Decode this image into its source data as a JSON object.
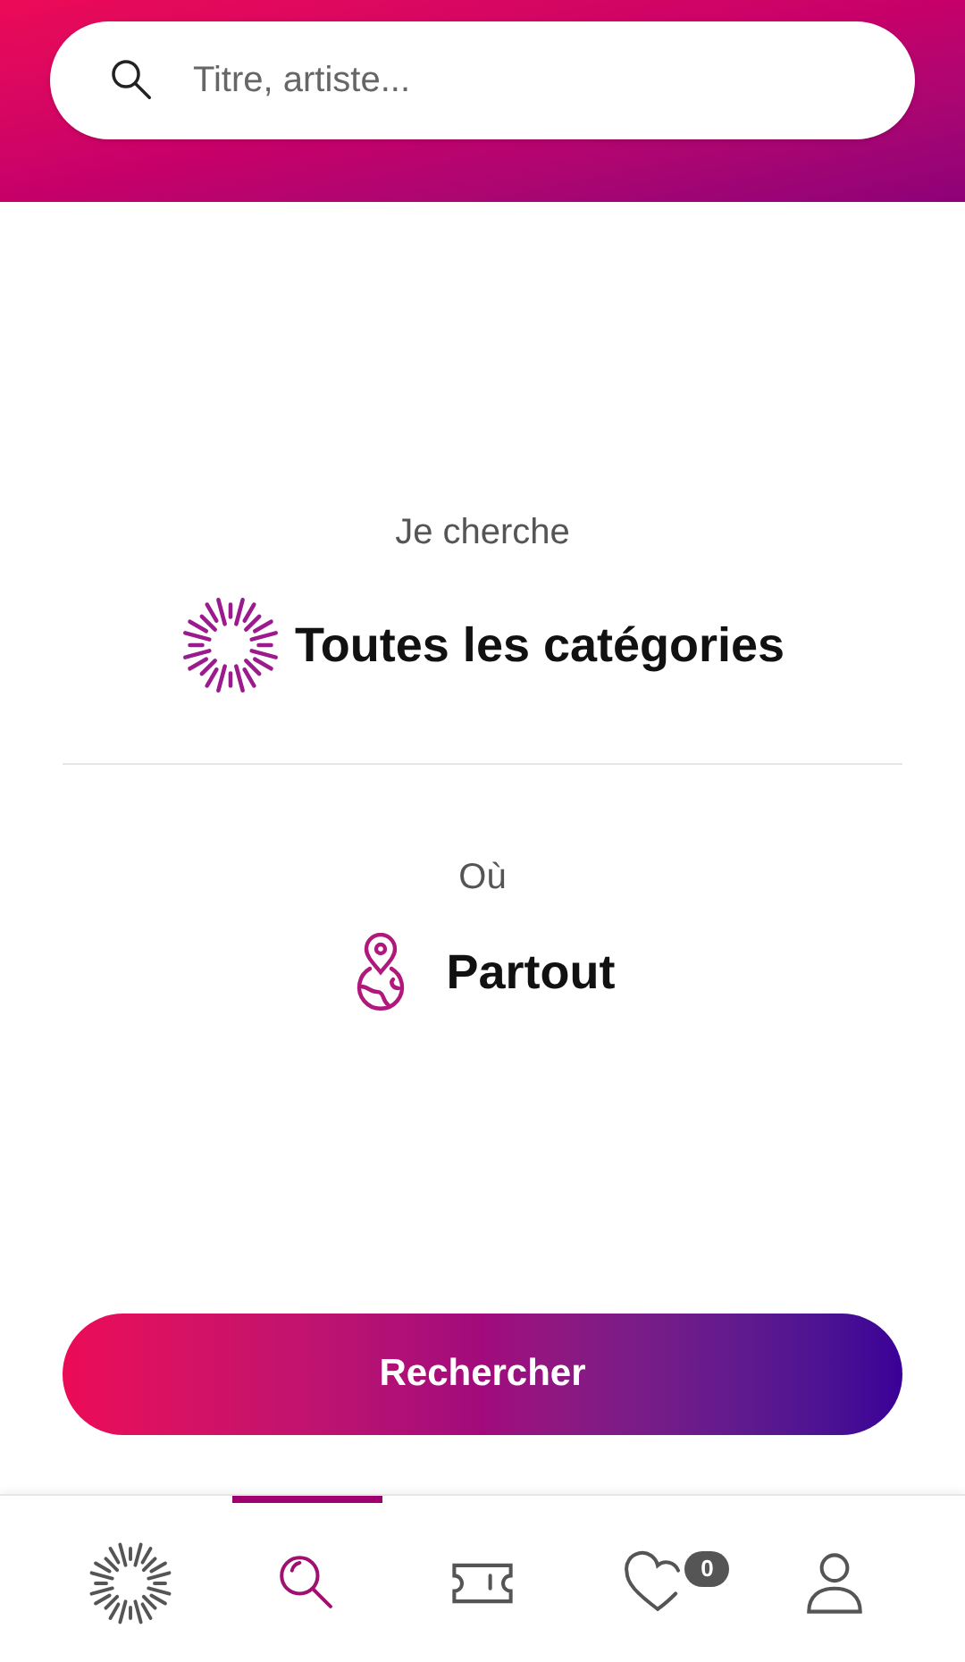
{
  "search": {
    "placeholder": "Titre, artiste..."
  },
  "category": {
    "label": "Je cherche",
    "value": "Toutes les catégories"
  },
  "location": {
    "label": "Où",
    "value": "Partout"
  },
  "submit": {
    "label": "Rechercher"
  },
  "nav": [
    {
      "kind": "discover",
      "selected": false
    },
    {
      "kind": "search",
      "selected": true
    },
    {
      "kind": "tickets",
      "selected": false
    },
    {
      "kind": "favorites",
      "selected": false,
      "badge": "0"
    },
    {
      "kind": "profile",
      "selected": false
    }
  ]
}
